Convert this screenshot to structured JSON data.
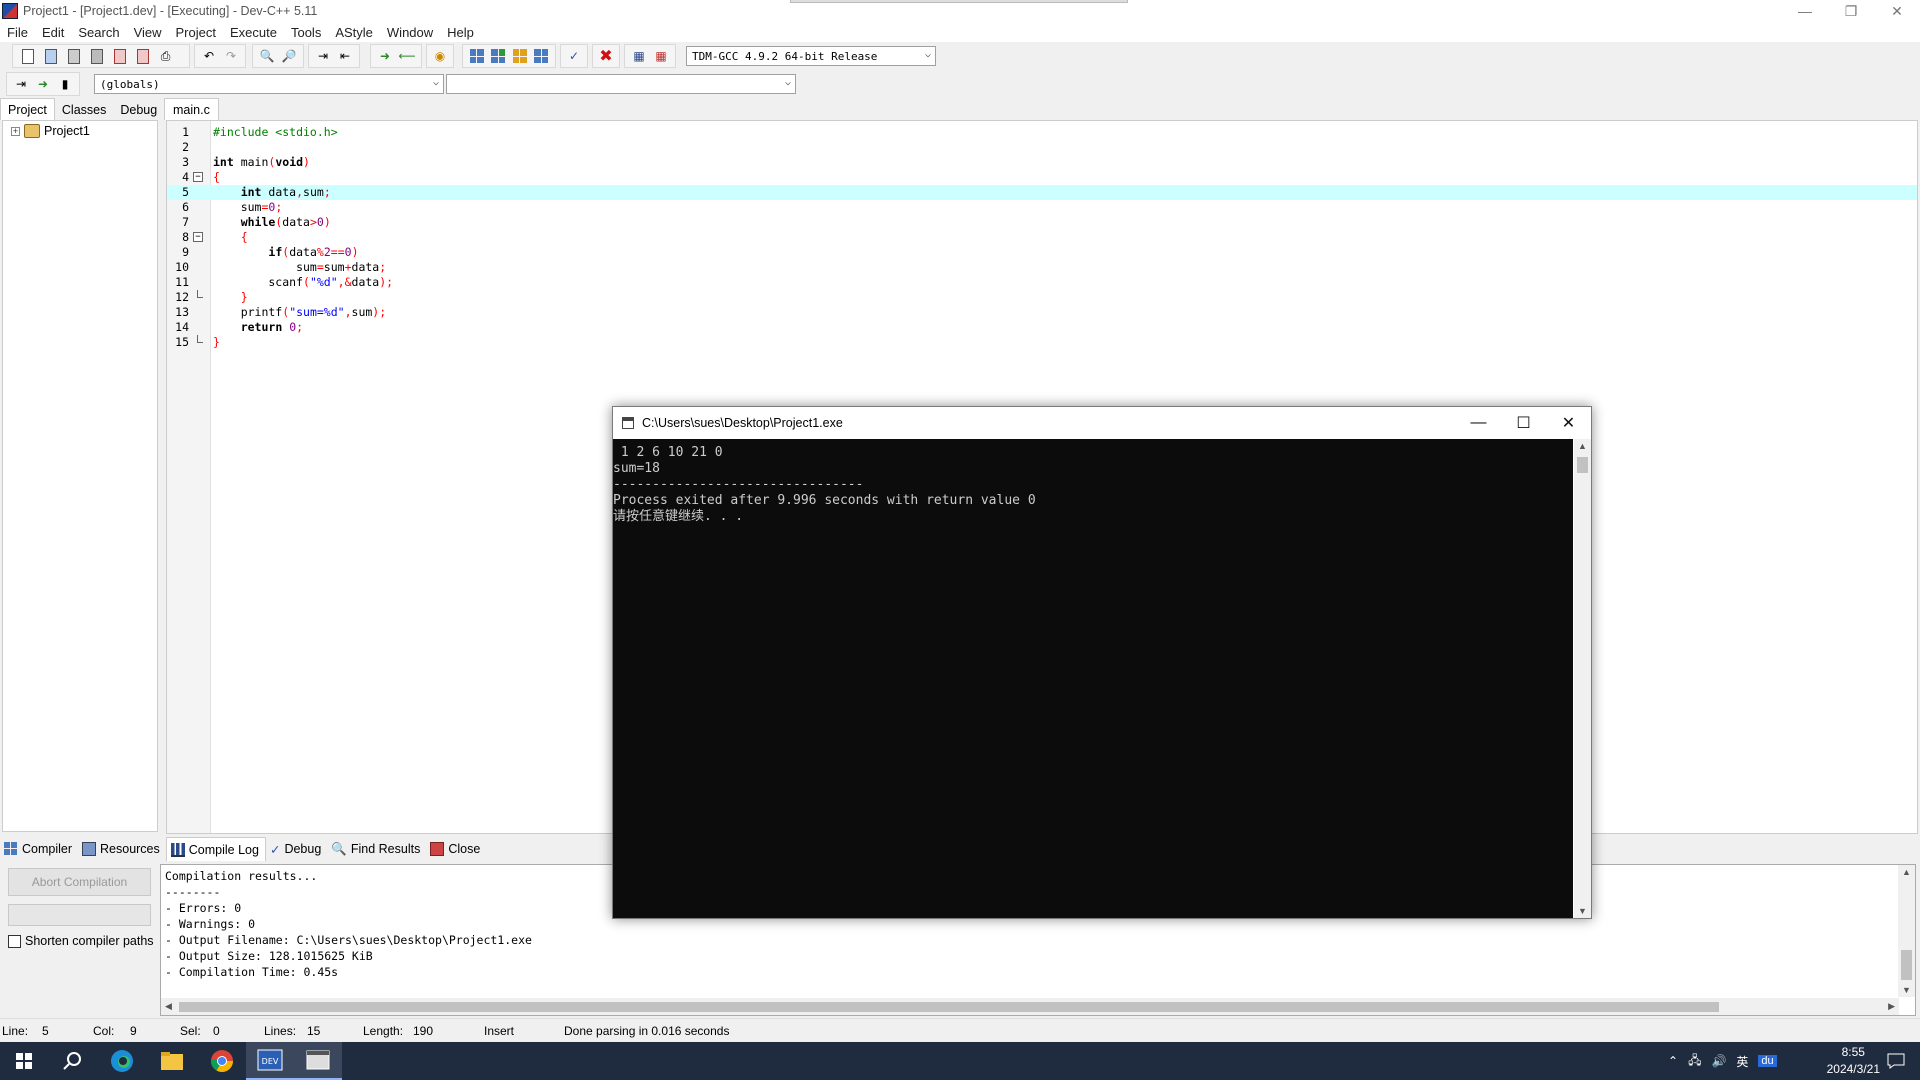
{
  "window": {
    "title": "Project1 - [Project1.dev] - [Executing] - Dev-C++ 5.11"
  },
  "menu": [
    "File",
    "Edit",
    "Search",
    "View",
    "Project",
    "Execute",
    "Tools",
    "AStyle",
    "Window",
    "Help"
  ],
  "toolbar": {
    "compiler_select": "TDM-GCC 4.9.2 64-bit Release",
    "scope_select": "(globals)",
    "function_select": ""
  },
  "left_panel": {
    "tabs": [
      "Project",
      "Classes",
      "Debug"
    ],
    "tree_root": "Project1"
  },
  "editor": {
    "file_tab": "main.c",
    "lines": [
      {
        "n": "1",
        "text": "#include <stdio.h>"
      },
      {
        "n": "2",
        "text": ""
      },
      {
        "n": "3",
        "text": "int main(void)"
      },
      {
        "n": "4",
        "text": "{"
      },
      {
        "n": "5",
        "text": "    int data,sum;"
      },
      {
        "n": "6",
        "text": "    sum=0;"
      },
      {
        "n": "7",
        "text": "    while(data>0)"
      },
      {
        "n": "8",
        "text": "    {"
      },
      {
        "n": "9",
        "text": "        if(data%2==0)"
      },
      {
        "n": "10",
        "text": "            sum=sum+data;"
      },
      {
        "n": "11",
        "text": "        scanf(\"%d\",&data);"
      },
      {
        "n": "12",
        "text": "    }"
      },
      {
        "n": "13",
        "text": "    printf(\"sum=%d\",sum);"
      },
      {
        "n": "14",
        "text": "    return 0;"
      },
      {
        "n": "15",
        "text": "}"
      }
    ],
    "highlight_line": 5
  },
  "bottom_panel": {
    "tabs": [
      "Compiler",
      "Resources",
      "Compile Log",
      "Debug",
      "Find Results",
      "Close"
    ],
    "active_tab": "Compile Log",
    "abort_button": "Abort Compilation",
    "shorten_paths_label": "Shorten compiler paths",
    "log_lines": [
      "Compilation results...",
      "--------",
      "- Errors: 0",
      "- Warnings: 0",
      "- Output Filename: C:\\Users\\sues\\Desktop\\Project1.exe",
      "- Output Size: 128.1015625 KiB",
      "- Compilation Time: 0.45s"
    ]
  },
  "statusbar": {
    "line_label": "Line:",
    "line_value": "5",
    "col_label": "Col:",
    "col_value": "9",
    "sel_label": "Sel:",
    "sel_value": "0",
    "lines_label": "Lines:",
    "lines_value": "15",
    "length_label": "Length:",
    "length_value": "190",
    "mode": "Insert",
    "message": "Done parsing in 0.016 seconds"
  },
  "console": {
    "title": "C:\\Users\\sues\\Desktop\\Project1.exe",
    "output": [
      " 1 2 6 10 21 0",
      "sum=18",
      "--------------------------------",
      "Process exited after 9.996 seconds with return value 0",
      "请按任意键继续. . ."
    ]
  },
  "taskbar": {
    "ime": "英",
    "time": "8:55",
    "date": "2024/3/21"
  }
}
